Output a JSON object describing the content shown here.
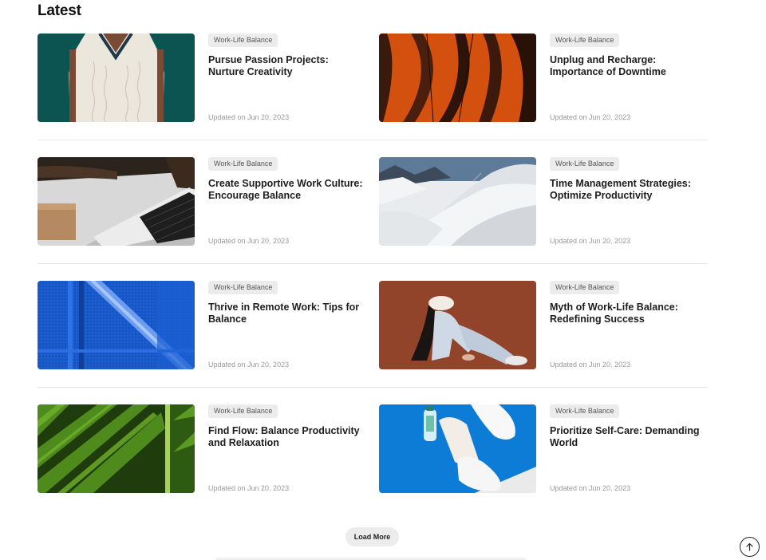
{
  "section_title": "Latest",
  "articles": [
    {
      "tag": "Work-Life Balance",
      "title": "Pursue Passion Projects: Nurture Creativity",
      "date": "Updated on Jun 20, 2023",
      "image": "knit-vest-photo"
    },
    {
      "tag": "Work-Life Balance",
      "title": "Unplug and Recharge: Importance of Downtime",
      "date": "Updated on Jun 20, 2023",
      "image": "orange-leaves-photo"
    },
    {
      "tag": "Work-Life Balance",
      "title": "Create Supportive Work Culture: Encourage Balance",
      "date": "Updated on Jun 20, 2023",
      "image": "laptop-typing-photo"
    },
    {
      "tag": "Work-Life Balance",
      "title": "Time Management Strategies: Optimize Productivity",
      "date": "Updated on Jun 20, 2023",
      "image": "snowy-mountain-photo"
    },
    {
      "tag": "Work-Life Balance",
      "title": "Thrive in Remote Work: Tips for Balance",
      "date": "Updated on Jun 20, 2023",
      "image": "blue-mesh-photo"
    },
    {
      "tag": "Work-Life Balance",
      "title": "Myth of Work-Life Balance: Redefining Success",
      "date": "Updated on Jun 20, 2023",
      "image": "woman-sitting-photo"
    },
    {
      "tag": "Work-Life Balance",
      "title": "Find Flow: Balance Productivity and Relaxation",
      "date": "Updated on Jun 20, 2023",
      "image": "green-leaf-photo"
    },
    {
      "tag": "Work-Life Balance",
      "title": "Prioritize Self-Care: Demanding World",
      "date": "Updated on Jun 20, 2023",
      "image": "sneakers-bottle-photo"
    }
  ],
  "load_more_label": "Load More",
  "icons": {
    "back_to_top": "arrow-up-icon"
  },
  "colors": {
    "tag_bg": "#ececec",
    "divider": "#e6e6e6",
    "date_text": "#9a9a9a"
  }
}
